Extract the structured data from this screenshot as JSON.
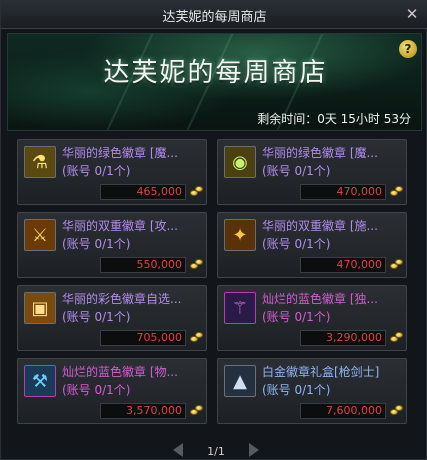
{
  "window": {
    "title": "达芙妮的每周商店",
    "close_icon": "close-icon"
  },
  "banner": {
    "title": "达芙妮的每周商店",
    "help_label": "?",
    "timer": "剩余时间：0天 15小时 53分"
  },
  "items": [
    {
      "name": "华丽的绿色徽章 [魔...",
      "limit": "(账号 0/1个)",
      "price": "465,000",
      "icon": "green-emblem-icon",
      "rarity": "green"
    },
    {
      "name": "华丽的绿色徽章 [魔...",
      "limit": "(账号 0/1个)",
      "price": "470,000",
      "icon": "green-emblem-icon",
      "rarity": "green"
    },
    {
      "name": "华丽的双重徽章 [攻...",
      "limit": "(账号 0/1个)",
      "price": "550,000",
      "icon": "dual-emblem-icon",
      "rarity": "green"
    },
    {
      "name": "华丽的双重徽章 [施...",
      "limit": "(账号 0/1个)",
      "price": "470,000",
      "icon": "dual-emblem-icon",
      "rarity": "green"
    },
    {
      "name": "华丽的彩色徽章自选...",
      "limit": "(账号 0/1个)",
      "price": "705,000",
      "icon": "color-emblem-box-icon",
      "rarity": "green"
    },
    {
      "name": "灿烂的蓝色徽章 [独...",
      "limit": "(账号 0/1个)",
      "price": "3,290,000",
      "icon": "blue-emblem-icon",
      "rarity": "pink"
    },
    {
      "name": "灿烂的蓝色徽章 [物...",
      "limit": "(账号 0/1个)",
      "price": "3,570,000",
      "icon": "blue-emblem-icon",
      "rarity": "pink"
    },
    {
      "name": "白金徽章礼盒[枪剑士]",
      "limit": "(账号 0/1个)",
      "price": "7,600,000",
      "icon": "platinum-emblem-box-icon",
      "rarity": "blue"
    }
  ],
  "pager": {
    "page": "1/1"
  },
  "colors": {
    "price": "#e04040",
    "green_tier": "#b38cf0",
    "pink_tier": "#d45cd6",
    "blue_tier": "#8fb4f4"
  }
}
